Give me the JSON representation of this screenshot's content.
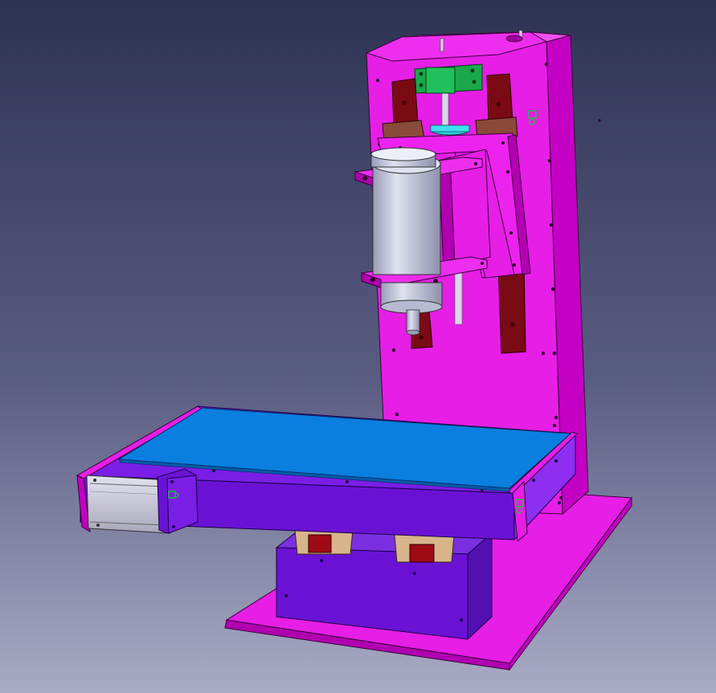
{
  "scene": {
    "background_top": "#2f3354",
    "background_bottom": "#a6a8c4",
    "part_magenta": "#e61ee6",
    "part_magenta_dark": "#b800b8",
    "part_purple": "#6a12d4",
    "part_purple_dark": "#4a0a9a",
    "table_top_blue": "#0a7fe0",
    "rail_red": "#7a0a14",
    "carriage_brown": "#8a4a3a",
    "motor_gray": "#c8c8d8",
    "spindle_gray": "#c4c6dc",
    "coupling_green": "#1aa84a",
    "nut_cyan": "#30d0e0",
    "axis_marker_green": "#20c040"
  },
  "icons": {
    "axis_marker": "axis-marker-icon"
  }
}
